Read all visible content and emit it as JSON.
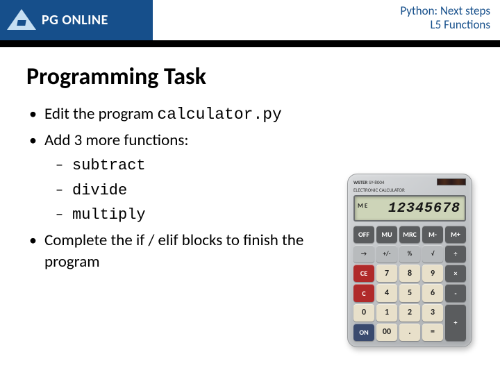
{
  "header": {
    "logo_pg": "PG",
    "logo_online": " ONLINE",
    "course": "Python: Next steps",
    "lesson": "L5 Functions"
  },
  "title": "Programming Task",
  "bullets": {
    "b1_pre": "Edit the program ",
    "b1_code": "calculator.py",
    "b2": "Add 3 more functions:",
    "subs": [
      "subtract",
      "divide",
      "multiply"
    ],
    "b3": "Complete the if / elif blocks to finish the program"
  },
  "calc": {
    "brand": "WSTER",
    "model": "SY-8004",
    "subtitle": "ELECTRONIC CALCULATOR",
    "me": "M E",
    "display": "12345678",
    "keys_row0": [
      "OFF",
      "MU",
      "MRC",
      "M-",
      "M+"
    ],
    "keys_row1": [
      "→",
      "+/-",
      "%",
      "√",
      "÷"
    ],
    "keys_row2": [
      "CE",
      "7",
      "8",
      "9",
      "×"
    ],
    "keys_row3": [
      "C",
      "4",
      "5",
      "6",
      "-"
    ],
    "keys_row4": [
      "0",
      "1",
      "2",
      "3",
      "+"
    ],
    "keys_row5": [
      "ON",
      "00",
      ".",
      "="
    ]
  }
}
